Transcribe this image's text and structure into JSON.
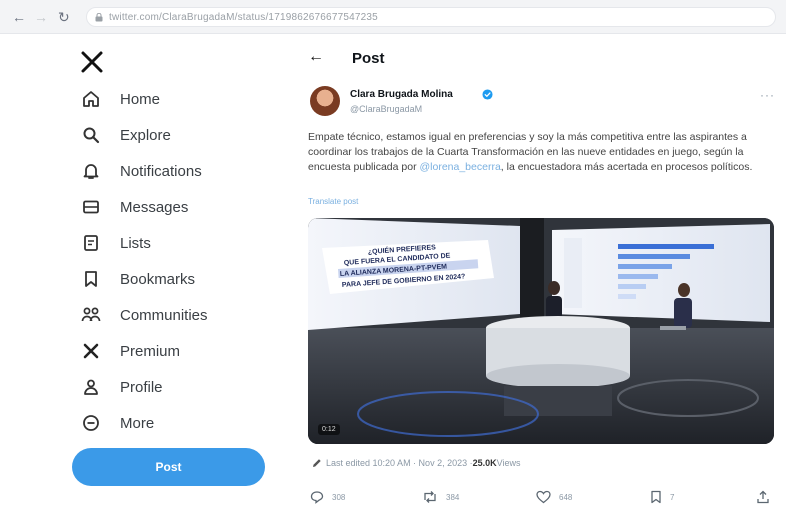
{
  "browser": {
    "url": "twitter.com/ClaraBrugadaM/status/1719862676677547235"
  },
  "sidebar": {
    "items": [
      {
        "label": "Home",
        "icon": "home-icon"
      },
      {
        "label": "Explore",
        "icon": "search-icon"
      },
      {
        "label": "Notifications",
        "icon": "bell-icon"
      },
      {
        "label": "Messages",
        "icon": "mail-icon"
      },
      {
        "label": "Lists",
        "icon": "list-icon"
      },
      {
        "label": "Bookmarks",
        "icon": "bookmark-icon"
      },
      {
        "label": "Communities",
        "icon": "communities-icon"
      },
      {
        "label": "Premium",
        "icon": "x-premium-icon"
      },
      {
        "label": "Profile",
        "icon": "profile-icon"
      },
      {
        "label": "More",
        "icon": "more-circle-icon"
      }
    ],
    "post_button": "Post"
  },
  "header": {
    "title": "Post"
  },
  "tweet": {
    "author_name": "Clara Brugada Molina",
    "author_handle": "@ClaraBrugadaM",
    "text_before_mention": "Empate técnico, estamos igual en preferencias y soy la más competitiva entre las aspirantes a coordinar los trabajos de la Cuarta Transformación en las nueve entidades en juego, según la encuesta publicada por ",
    "mention": "@lorena_becerra",
    "text_after_mention": ", la encuestadora más acertada en procesos políticos.",
    "translate": "Translate post",
    "media_badge": "0:12",
    "media_screen_text": "¿QUIÉN PREFIERES QUE FUERA EL CANDIDATO DE LA ALIANZA MORENA-PT-PVEM PARA JEFE DE GOBIERNO EN 2024?",
    "edited_prefix": "Last edited 10:20 AM · Nov 2, 2023 · ",
    "views_count": "25.0K",
    "views_label": " Views"
  },
  "actions": {
    "replies": "308",
    "reposts": "384",
    "likes": "648",
    "bookmarks": "7"
  },
  "colors": {
    "accent": "#3b9ae8",
    "link": "#7ab0e0",
    "muted": "#8b98a5"
  }
}
